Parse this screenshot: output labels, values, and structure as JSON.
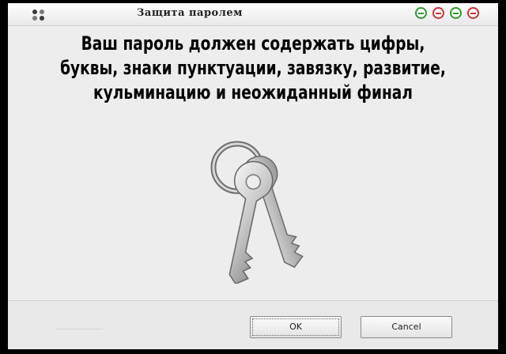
{
  "window": {
    "title": "Защита паролем",
    "controls": [
      "minimize",
      "minimize",
      "minimize",
      "close"
    ],
    "accent_colors": {
      "red": "#c43333",
      "green": "#2f9a2f"
    }
  },
  "dialog": {
    "message_lines": [
      "Ваш пароль должен содержать цифры,",
      "буквы, знаки пунктуации, завязку, развитие,",
      "кульминацию и неожиданный финал"
    ],
    "icon": "keys-icon"
  },
  "buttons": {
    "ok": "OK",
    "cancel": "Cancel"
  }
}
